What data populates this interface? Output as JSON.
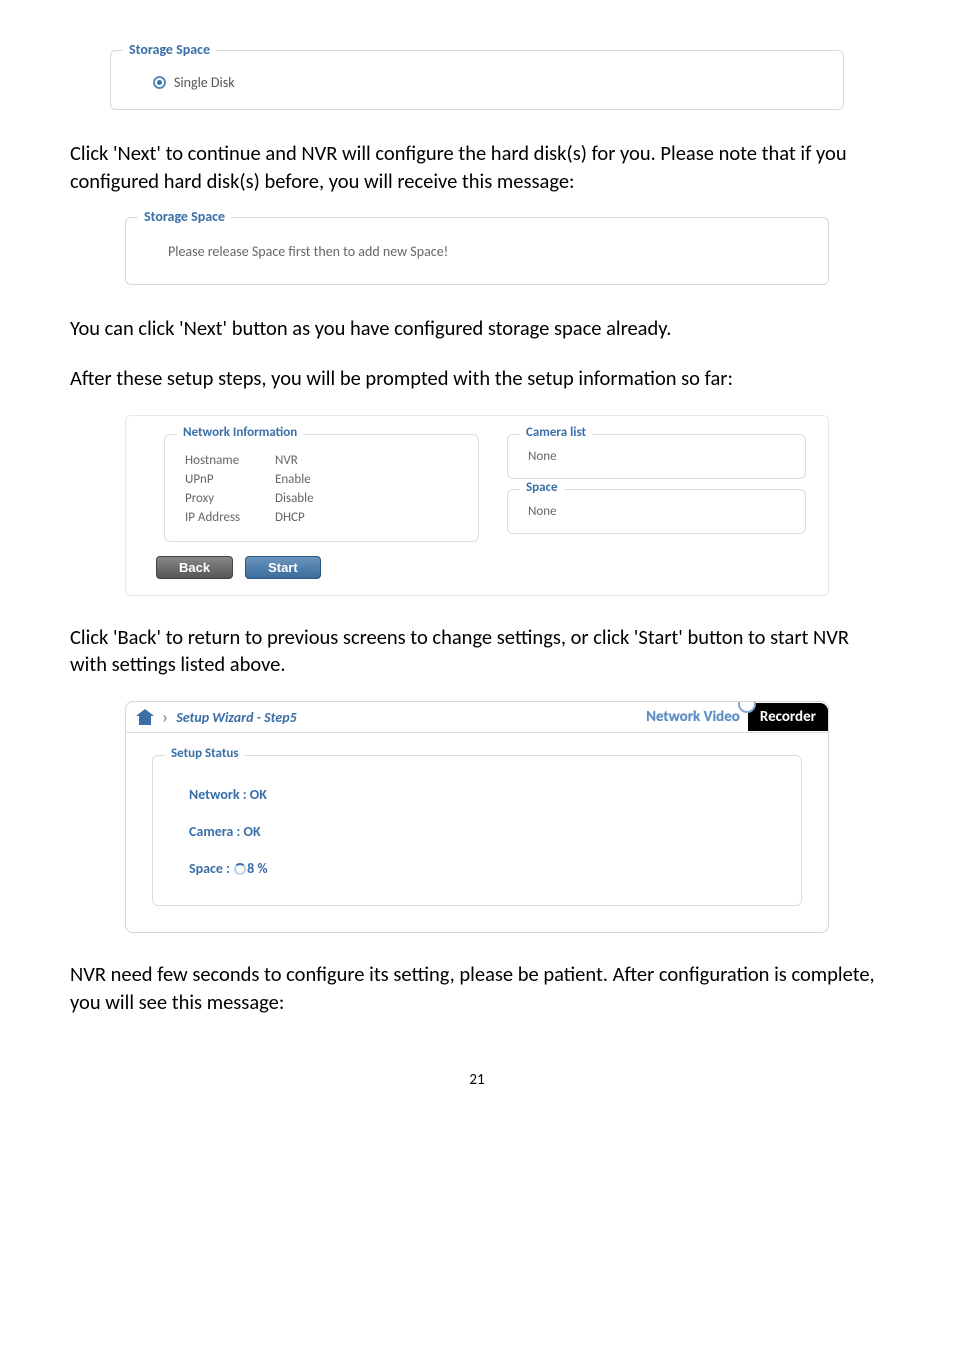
{
  "storage_space_1": {
    "legend": "Storage Space",
    "option": "Single Disk"
  },
  "para1": "Click 'Next' to continue and NVR will configure the hard disk(s) for you. Please note that if you configured hard disk(s) before, you will receive this message:",
  "storage_space_2": {
    "legend": "Storage Space",
    "message": "Please release Space first then to add new Space!"
  },
  "para2": "You can click 'Next' button as you have configured storage space already.",
  "para3": "After these setup steps, you will be prompted with the setup information so far:",
  "network_info": {
    "legend": "Network Information",
    "rows": [
      {
        "k": "Hostname",
        "v": "NVR"
      },
      {
        "k": "UPnP",
        "v": "Enable"
      },
      {
        "k": "Proxy",
        "v": "Disable"
      },
      {
        "k": "IP Address",
        "v": "DHCP"
      }
    ]
  },
  "camera_list": {
    "legend": "Camera list",
    "value": "None"
  },
  "space_box": {
    "legend": "Space",
    "value": "None"
  },
  "buttons": {
    "back": "Back",
    "start": "Start"
  },
  "para4": "Click 'Back' to return to previous screens to change settings, or click 'Start' button to start NVR with settings listed above.",
  "wizard": {
    "breadcrumb": "Setup Wizard - Step5",
    "brand_left": "Network Video",
    "brand_right": "Recorder",
    "setup_legend": "Setup Status",
    "lines": {
      "network": "Network : OK",
      "camera": "Camera : OK",
      "space_prefix": "Space : ",
      "space_pct": "8 %"
    }
  },
  "para5": "NVR need few seconds to configure its setting, please be patient. After configuration is complete, you will see this message:",
  "page_number": "21"
}
